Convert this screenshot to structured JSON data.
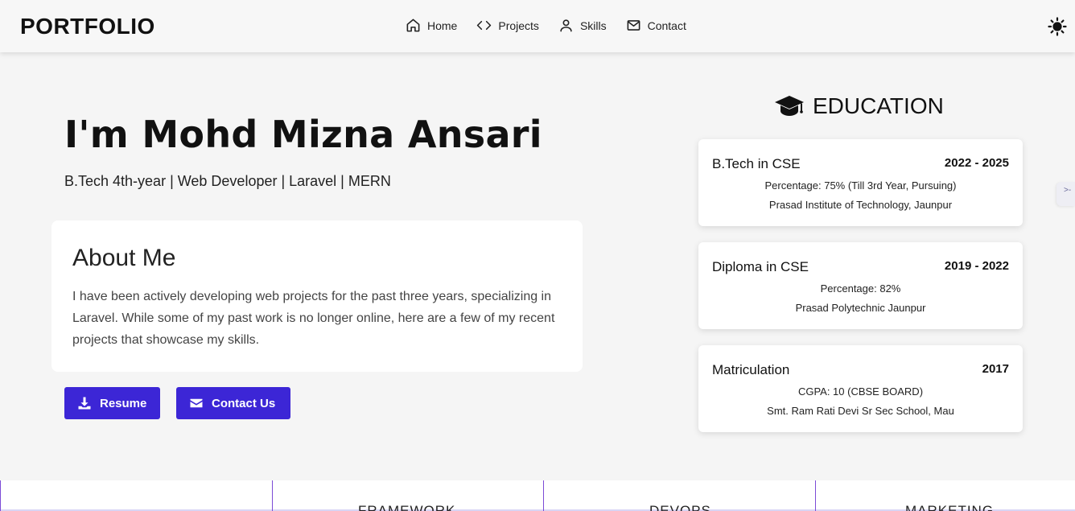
{
  "navbar": {
    "brand": "PORTFOLIO",
    "links": [
      {
        "label": "Home",
        "icon": "home-icon"
      },
      {
        "label": "Projects",
        "icon": "code-icon"
      },
      {
        "label": "Skills",
        "icon": "user-icon"
      },
      {
        "label": "Contact",
        "icon": "mail-icon"
      }
    ],
    "theme_toggle_icon": "sun-icon"
  },
  "hero": {
    "title": "I'm Mohd Mizna Ansari",
    "subtitle": "B.Tech 4th-year | Web Developer | Laravel | MERN"
  },
  "about": {
    "title": "About Me",
    "text": "I have been actively developing web projects for the past three years, specializing in Laravel. While some of my past work is no longer online, here are a few of my recent projects that showcase my skills."
  },
  "buttons": {
    "resume_label": "Resume",
    "contact_label": "Contact Us"
  },
  "education": {
    "heading": "EDUCATION",
    "items": [
      {
        "degree": "B.Tech in CSE",
        "years": "2022 - 2025",
        "detail1": "Percentage: 75% (Till 3rd Year, Pursuing)",
        "detail2": "Prasad Institute of Technology, Jaunpur"
      },
      {
        "degree": "Diploma in CSE",
        "years": "2019 - 2022",
        "detail1": "Percentage: 82%",
        "detail2": "Prasad Polytechnic Jaunpur"
      },
      {
        "degree": "Matriculation",
        "years": "2017",
        "detail1": "CGPA: 10 (CBSE BOARD)",
        "detail2": "Smt. Ram Rati Devi Sr Sec School, Mau"
      }
    ]
  },
  "side_tab": {
    "label": ">-"
  },
  "bottom_strip": {
    "labels": [
      "FRAMEWORK",
      "DEVOPS",
      "MARKETING"
    ]
  },
  "colors": {
    "accent": "#3c26d6",
    "background": "#f5f5f5",
    "card": "#ffffff",
    "divider": "#7c4bd6"
  }
}
